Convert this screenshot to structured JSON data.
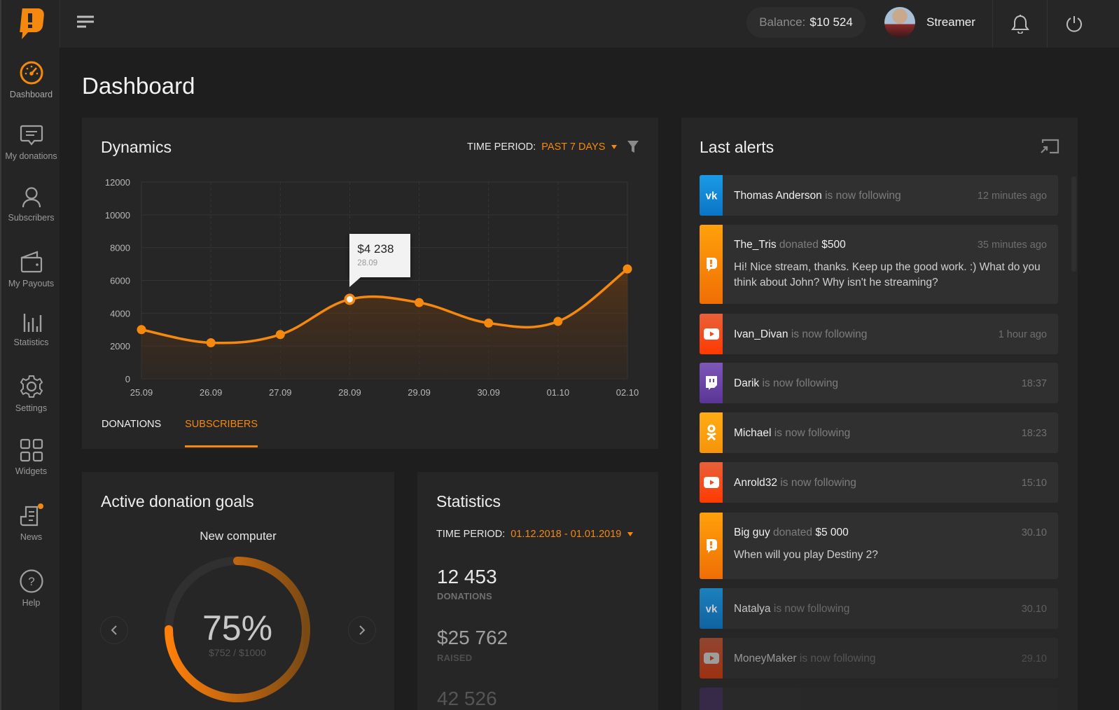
{
  "app": {
    "brand_color": "#f5890f"
  },
  "sidebar": {
    "items": [
      {
        "label": "Dashboard",
        "icon": "gauge-icon",
        "active": true
      },
      {
        "label": "My donations",
        "icon": "message-icon"
      },
      {
        "label": "Subscribers",
        "icon": "user-icon"
      },
      {
        "label": "My Payouts",
        "icon": "wallet-icon"
      },
      {
        "label": "Statistics",
        "icon": "bar-chart-icon"
      },
      {
        "label": "Settings",
        "icon": "gear-icon"
      },
      {
        "label": "Widgets",
        "icon": "grid-icon"
      },
      {
        "label": "News",
        "icon": "news-icon",
        "badge": true
      },
      {
        "label": "Help",
        "icon": "help-icon"
      }
    ]
  },
  "topbar": {
    "balance_label": "Balance:",
    "balance_value": "$10 524",
    "user_name": "Streamer"
  },
  "page": {
    "title": "Dashboard"
  },
  "dynamics": {
    "title": "Dynamics",
    "period_label": "TIME PERIOD:",
    "period_value": "PAST 7 DAYS",
    "tabs": [
      {
        "label": "DONATIONS",
        "active": false
      },
      {
        "label": "SUBSCRIBERS",
        "active": true
      }
    ],
    "tooltip": {
      "value": "$4 238",
      "date": "28.09"
    }
  },
  "chart_data": {
    "type": "area",
    "title": "Dynamics",
    "xlabel": "",
    "ylabel": "",
    "categories": [
      "25.09",
      "26.09",
      "27.09",
      "28.09",
      "29.09",
      "30.09",
      "01.10",
      "02.10"
    ],
    "series": [
      {
        "name": "Subscribers",
        "values": [
          3000,
          2200,
          2700,
          4850,
          4650,
          3400,
          3500,
          6700
        ]
      }
    ],
    "yticks": [
      0,
      2000,
      4000,
      6000,
      8000,
      10000,
      12000
    ],
    "ylim": [
      0,
      12000
    ],
    "grid": true,
    "highlighted_index": 3,
    "color": "#f5890f"
  },
  "goals": {
    "title": "Active donation goals",
    "goal_name": "New computer",
    "percent_label": "75%",
    "progress": 0.75,
    "amount": "$752 / $1000"
  },
  "statistics": {
    "title": "Statistics",
    "period_label": "TIME PERIOD:",
    "period_value": "01.12.2018 - 01.01.2019",
    "stats": [
      {
        "value": "12 453",
        "label": "DONATIONS"
      },
      {
        "value": "$25 762",
        "label": "RAISED"
      },
      {
        "value": "42 526",
        "label": ""
      }
    ]
  },
  "alerts": {
    "title": "Last alerts",
    "items": [
      {
        "platform": "vk",
        "name": "Thomas Anderson",
        "action": "is now following",
        "amount": "",
        "time": "12 minutes ago",
        "message": ""
      },
      {
        "platform": "donationalerts",
        "name": "The_Tris",
        "action": "donated",
        "amount": "$500",
        "time": "35 minutes ago",
        "message": "Hi! Nice stream, thanks. Keep up the good work. :) What do you think about John? Why isn't he streaming?"
      },
      {
        "platform": "youtube",
        "name": "Ivan_Divan",
        "action": "is now following",
        "amount": "",
        "time": "1 hour ago",
        "message": ""
      },
      {
        "platform": "twitch",
        "name": "Darik",
        "action": "is now following",
        "amount": "",
        "time": "18:37",
        "message": ""
      },
      {
        "platform": "odnoklassniki",
        "name": "Michael",
        "action": "is now following",
        "amount": "",
        "time": "18:23",
        "message": ""
      },
      {
        "platform": "youtube",
        "name": "Anrold32",
        "action": "is now following",
        "amount": "",
        "time": "15:10",
        "message": ""
      },
      {
        "platform": "donationalerts",
        "name": "Big guy",
        "action": "donated",
        "amount": "$5 000",
        "time": "30.10",
        "message": "When will you play Destiny 2?"
      },
      {
        "platform": "vk",
        "name": "Natalya",
        "action": "is now following",
        "amount": "",
        "time": "30.10",
        "message": ""
      },
      {
        "platform": "youtube",
        "name": "MoneyMaker",
        "action": "is now following",
        "amount": "",
        "time": "29.10",
        "message": ""
      }
    ]
  }
}
